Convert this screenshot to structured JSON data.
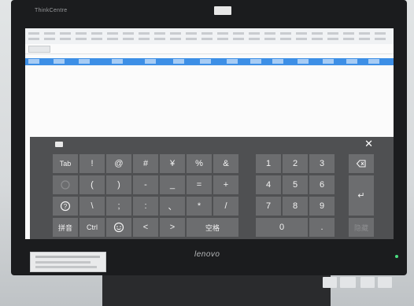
{
  "brand_top": "ThinkCentre",
  "keyboard": {
    "close": "✕",
    "symbol_rows": [
      [
        "Tab",
        "!",
        "@",
        "#",
        "¥",
        "%",
        "&"
      ],
      [
        "",
        "(",
        ")",
        "-",
        "_",
        "=",
        "+"
      ],
      [
        "",
        "\\",
        ";",
        ":",
        "、",
        "*",
        "/"
      ],
      [
        "拼音",
        "Ctrl",
        "",
        "<",
        ">",
        "空格"
      ]
    ],
    "numpad": [
      [
        "1",
        "2",
        "3"
      ],
      [
        "4",
        "5",
        "6"
      ],
      [
        "7",
        "8",
        "9"
      ],
      [
        "0",
        "."
      ]
    ],
    "side": {
      "backspace": "",
      "enter": "↵",
      "done": "隐藏"
    }
  },
  "logo": "lenovo",
  "colors": {
    "bezel": "#1b1c1e",
    "keyboard_bg": "#4f5052",
    "key_bg": "#6c6d6f",
    "selected_row": "#3d8fe6"
  }
}
